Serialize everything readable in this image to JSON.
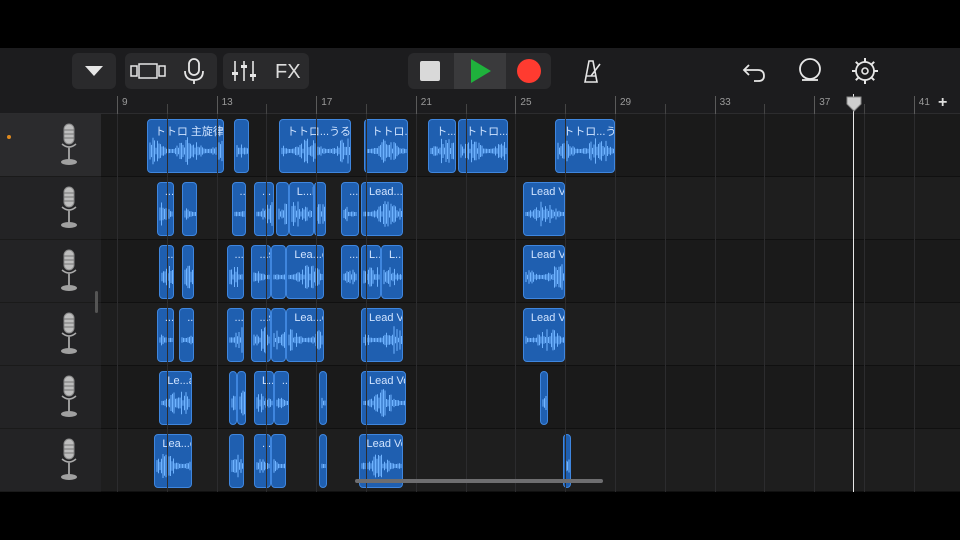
{
  "toolbar": {
    "fx_label": "FX",
    "icons": [
      "track-menu-icon",
      "browser-icon",
      "microphone-icon",
      "mixer-icon",
      "stop-icon",
      "play-icon",
      "record-icon",
      "metronome-icon",
      "undo-icon",
      "loop-icon",
      "settings-icon"
    ],
    "colors": {
      "play": "#1fb23c",
      "record": "#ff3b30"
    }
  },
  "ruler": {
    "labels": [
      "9",
      "13",
      "17",
      "21",
      "25",
      "29",
      "33",
      "37",
      "41"
    ],
    "add_label": "+"
  },
  "tracks": [
    {
      "instrument": "microphone",
      "selected": true,
      "regions": [
        {
          "label": "トトロ 主旋律 うるさ",
          "bars": [
            10.2,
            13.3
          ]
        },
        {
          "label": "",
          "bars": [
            13.7,
            14.3
          ]
        },
        {
          "label": "トトロ...うるさ",
          "bars": [
            15.5,
            18.4
          ]
        },
        {
          "label": "トトロ...るさ",
          "bars": [
            18.9,
            20.7
          ]
        },
        {
          "label": "ト...さ",
          "bars": [
            21.5,
            22.6
          ]
        },
        {
          "label": "トトロ...うるさ",
          "bars": [
            22.7,
            24.7
          ]
        },
        {
          "label": "トトロ...うるさ",
          "bars": [
            26.6,
            29.0
          ]
        }
      ]
    },
    {
      "instrument": "microphone",
      "selected": false,
      "regions": [
        {
          "label": "...",
          "bars": [
            10.6,
            11.3
          ]
        },
        {
          "label": "",
          "bars": [
            11.6,
            12.2
          ]
        },
        {
          "label": "...",
          "bars": [
            13.6,
            14.2
          ]
        },
        {
          "label": "...",
          "bars": [
            14.5,
            15.3
          ]
        },
        {
          "label": "",
          "bars": [
            15.4,
            15.9
          ]
        },
        {
          "label": "L...ls",
          "bars": [
            15.9,
            16.9
          ]
        },
        {
          "label": "",
          "bars": [
            16.9,
            17.4
          ]
        },
        {
          "label": "...",
          "bars": [
            18.0,
            18.7
          ]
        },
        {
          "label": "Lead...cals",
          "bars": [
            18.8,
            20.5
          ]
        },
        {
          "label": "Lead Vocals",
          "bars": [
            25.3,
            27.0
          ]
        }
      ]
    },
    {
      "instrument": "microphone",
      "selected": false,
      "regions": [
        {
          "label": "...",
          "bars": [
            10.7,
            11.3
          ]
        },
        {
          "label": "",
          "bars": [
            11.6,
            12.1
          ]
        },
        {
          "label": "...",
          "bars": [
            13.4,
            14.1
          ]
        },
        {
          "label": "...s",
          "bars": [
            14.4,
            15.2
          ]
        },
        {
          "label": "",
          "bars": [
            15.2,
            15.8
          ]
        },
        {
          "label": "Lea...cals",
          "bars": [
            15.8,
            17.3
          ]
        },
        {
          "label": "...",
          "bars": [
            18.0,
            18.7
          ]
        },
        {
          "label": "L...s",
          "bars": [
            18.8,
            19.6
          ]
        },
        {
          "label": "L...s",
          "bars": [
            19.6,
            20.5
          ]
        },
        {
          "label": "Lead Vocals",
          "bars": [
            25.3,
            27.0
          ]
        }
      ]
    },
    {
      "instrument": "microphone",
      "selected": false,
      "regions": [
        {
          "label": "...",
          "bars": [
            10.6,
            11.3
          ]
        },
        {
          "label": "...",
          "bars": [
            11.5,
            12.1
          ]
        },
        {
          "label": "...",
          "bars": [
            13.4,
            14.1
          ]
        },
        {
          "label": "...s",
          "bars": [
            14.4,
            15.2
          ]
        },
        {
          "label": "",
          "bars": [
            15.2,
            15.8
          ]
        },
        {
          "label": "Lea...cals",
          "bars": [
            15.8,
            17.3
          ]
        },
        {
          "label": "Lead Vocals",
          "bars": [
            18.8,
            20.5
          ]
        },
        {
          "label": "Lead Vocals",
          "bars": [
            25.3,
            27.0
          ]
        }
      ]
    },
    {
      "instrument": "microphone",
      "selected": false,
      "regions": [
        {
          "label": "Le...als",
          "bars": [
            10.7,
            12.0
          ]
        },
        {
          "label": "",
          "bars": [
            13.5,
            13.8
          ]
        },
        {
          "label": "",
          "bars": [
            13.8,
            14.2
          ]
        },
        {
          "label": "L...s",
          "bars": [
            14.5,
            15.3
          ]
        },
        {
          "label": "...",
          "bars": [
            15.3,
            15.9
          ]
        },
        {
          "label": "",
          "bars": [
            17.1,
            17.4
          ]
        },
        {
          "label": "Lead Vocals",
          "bars": [
            18.8,
            20.6
          ]
        },
        {
          "label": "",
          "bars": [
            26.0,
            26.2
          ]
        }
      ]
    },
    {
      "instrument": "microphone",
      "selected": false,
      "regions": [
        {
          "label": "Lea...cals",
          "bars": [
            10.5,
            12.0
          ]
        },
        {
          "label": "",
          "bars": [
            13.5,
            14.1
          ]
        },
        {
          "label": "...",
          "bars": [
            14.5,
            15.2
          ]
        },
        {
          "label": "",
          "bars": [
            15.2,
            15.8
          ]
        },
        {
          "label": "",
          "bars": [
            17.1,
            17.4
          ]
        },
        {
          "label": "Lead Vocals",
          "bars": [
            18.7,
            20.5
          ]
        },
        {
          "label": "",
          "bars": [
            26.9,
            27.2
          ]
        }
      ]
    }
  ]
}
